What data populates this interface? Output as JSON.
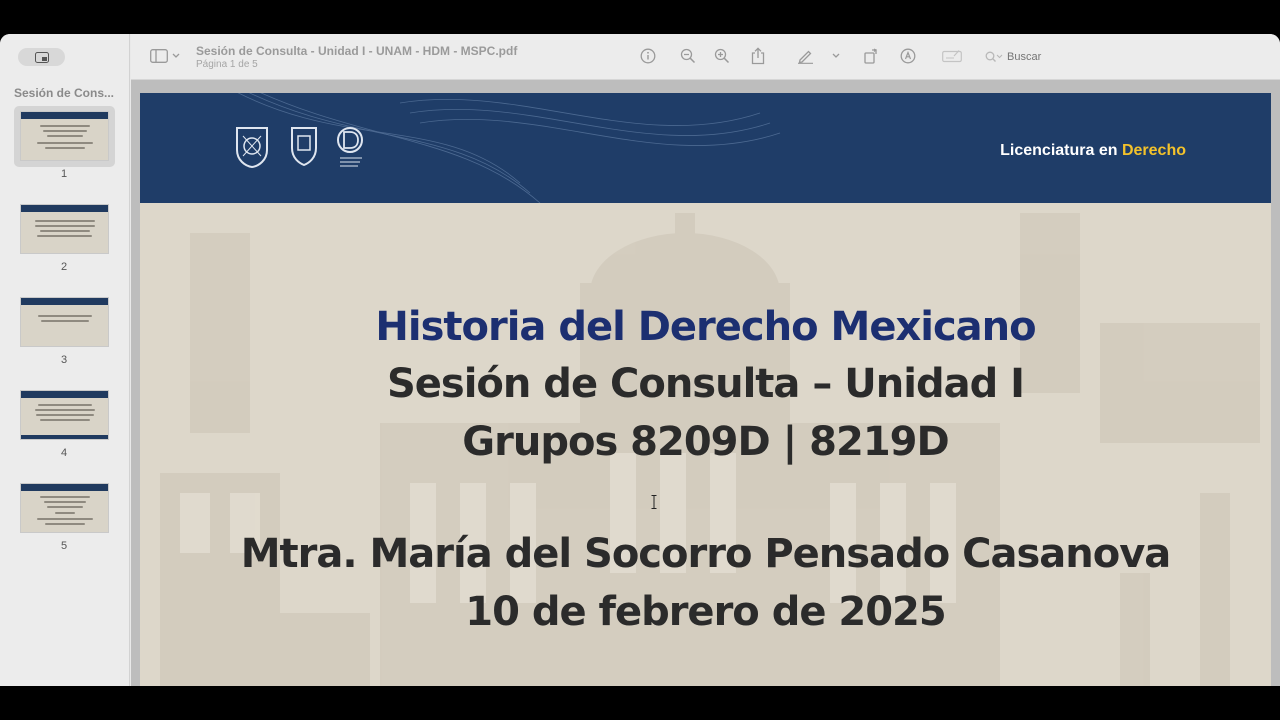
{
  "sidebar": {
    "title": "Sesión de Cons...",
    "pages": [
      {
        "number": "1",
        "selected": true
      },
      {
        "number": "2",
        "selected": false
      },
      {
        "number": "3",
        "selected": false
      },
      {
        "number": "4",
        "selected": false
      },
      {
        "number": "5",
        "selected": false
      }
    ]
  },
  "toolbar": {
    "document_title": "Sesión de Consulta - Unidad I - UNAM - HDM - MSPC.pdf",
    "page_indicator": "Página 1 de 5",
    "search_placeholder": "Buscar",
    "icons": [
      "sidebar-toggle-icon",
      "chevron-down-icon",
      "info-icon",
      "zoom-out-icon",
      "zoom-in-icon",
      "share-icon",
      "markup-pen-icon",
      "chevron-down-icon",
      "rotate-icon",
      "highlight-icon",
      "form-fill-icon",
      "search-icon"
    ]
  },
  "slide": {
    "banner": {
      "program_prefix": "Licenciatura en",
      "program_accent": "Derecho",
      "accent_color": "#f3c22b",
      "banner_color": "#1f3d68"
    },
    "title_line1": "Historia del Derecho Mexicano",
    "title_line2": "Sesión de Consulta – Unidad I",
    "title_line3": "Grupos 8209D | 8219D",
    "author": "Mtra. María del Socorro Pensado Casanova",
    "date": "10 de febrero de 2025",
    "title_color": "#1c2f71"
  }
}
